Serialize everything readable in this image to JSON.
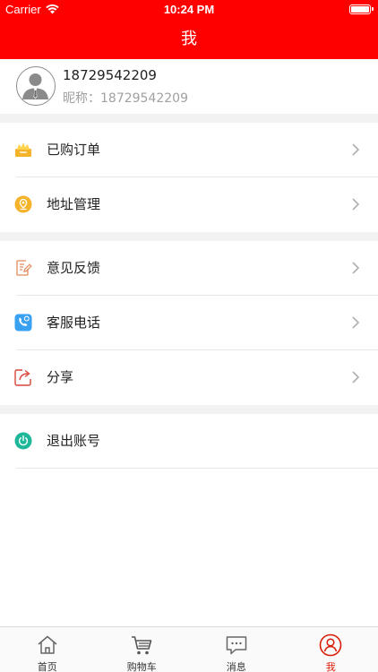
{
  "status_bar": {
    "carrier": "Carrier",
    "time": "10:24 PM"
  },
  "nav": {
    "title": "我"
  },
  "profile": {
    "phone": "18729542209",
    "nickname": "昵称：18729542209"
  },
  "menu": [
    {
      "label": "已购订单",
      "icon": "crown-box-icon"
    },
    {
      "label": "地址管理",
      "icon": "location-pin-icon"
    },
    {
      "label": "意见反馈",
      "icon": "feedback-edit-icon"
    },
    {
      "label": "客服电话",
      "icon": "phone-call-icon"
    },
    {
      "label": "分享",
      "icon": "share-icon"
    },
    {
      "label": "退出账号",
      "icon": "power-icon"
    }
  ],
  "tabs": [
    {
      "label": "首页",
      "icon": "home-icon"
    },
    {
      "label": "购物车",
      "icon": "cart-icon"
    },
    {
      "label": "消息",
      "icon": "message-icon"
    },
    {
      "label": "我",
      "icon": "user-icon"
    }
  ],
  "colors": {
    "brand_red": "#ff0000",
    "active_tab": "#d81e06",
    "divider": "#e8e8e8",
    "section_gap": "#f2f2f2"
  }
}
